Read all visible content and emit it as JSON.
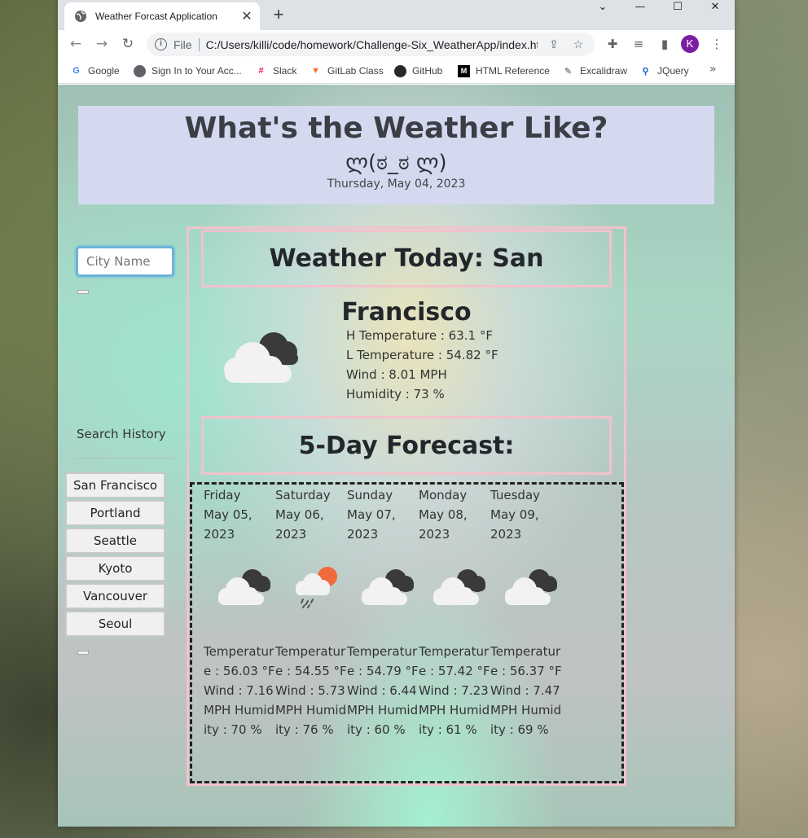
{
  "browser": {
    "tab_title": "Weather Forcast Application",
    "url_scheme": "File",
    "url": "C:/Users/killi/code/homework/Challenge-Six_WeatherApp/index.html",
    "avatar_letter": "K",
    "bookmarks": [
      {
        "label": "Google",
        "icon": "google-icon"
      },
      {
        "label": "Sign In to Your Acc...",
        "icon": "globe-icon"
      },
      {
        "label": "Slack",
        "icon": "slack-icon"
      },
      {
        "label": "GitLab Class",
        "icon": "gitlab-icon"
      },
      {
        "label": "GitHub",
        "icon": "github-icon"
      },
      {
        "label": "HTML Reference",
        "icon": "mdn-icon"
      },
      {
        "label": "Excalidraw",
        "icon": "excalidraw-icon"
      },
      {
        "label": "JQuery",
        "icon": "search-icon"
      }
    ]
  },
  "header": {
    "title": "What's the Weather Like?",
    "face": "ლ(ಠ_ಠ ლ)",
    "date": "Thursday, May 04, 2023"
  },
  "search": {
    "placeholder": "City Name"
  },
  "history": {
    "title": "Search History",
    "cities": [
      "San Francisco",
      "Portland",
      "Seattle",
      "Kyoto",
      "Vancouver",
      "Seoul"
    ]
  },
  "today": {
    "title": "Weather Today: San Francisco",
    "icon": "cloudy-icon",
    "high": "H Temperature : 63.1 °F",
    "low": "L Temperature : 54.82 °F",
    "wind": "Wind : 8.01 MPH",
    "humidity": "Humidity : 73 %"
  },
  "forecast": {
    "title": "5-Day Forecast:",
    "days": [
      {
        "weekday": "Friday",
        "date": "May 05, 2023",
        "icon": "cloudy-icon",
        "stats": "Temperature : 56.03 °F Wind : 7.16 MPH Humidity : 70 %"
      },
      {
        "weekday": "Saturday",
        "date": "May 06, 2023",
        "icon": "sun-rain-icon",
        "stats": "Temperature : 54.55 °F Wind : 5.73 MPH Humidity : 76 %"
      },
      {
        "weekday": "Sunday",
        "date": "May 07, 2023",
        "icon": "cloudy-icon",
        "stats": "Temperature : 54.79 °F Wind : 6.44 MPH Humidity : 60 %"
      },
      {
        "weekday": "Monday",
        "date": "May 08, 2023",
        "icon": "cloudy-icon",
        "stats": "Temperature : 57.42 °F Wind : 7.23 MPH Humidity : 61 %"
      },
      {
        "weekday": "Tuesday",
        "date": "May 09, 2023",
        "icon": "cloudy-icon",
        "stats": "Temperature : 56.37 °F Wind : 7.47 MPH Humidity : 69 %"
      }
    ]
  }
}
